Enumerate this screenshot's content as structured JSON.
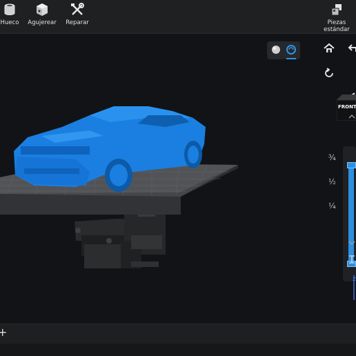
{
  "toolbar": {
    "items": [
      {
        "label": "Hueco",
        "icon": "hollow-icon"
      },
      {
        "label": "Agujerear",
        "icon": "cube-hole-icon"
      },
      {
        "label": "Reparar",
        "icon": "repair-tools-icon"
      }
    ],
    "standard_parts_label": "Piezas\nestándar"
  },
  "viewport": {
    "render_modes": [
      "solid-shading-icon",
      "xray-shading-icon"
    ],
    "active_render_mode": "xray-shading-icon",
    "view_cube_label": "FRONT",
    "layer_slider": {
      "marks": [
        "¾",
        "½",
        "¼"
      ],
      "range_fraction": [
        0.0,
        1.0
      ]
    }
  },
  "colors": {
    "accent": "#2d8fe0",
    "model": "#1a7fe0",
    "platform": "#3a3b3e"
  }
}
